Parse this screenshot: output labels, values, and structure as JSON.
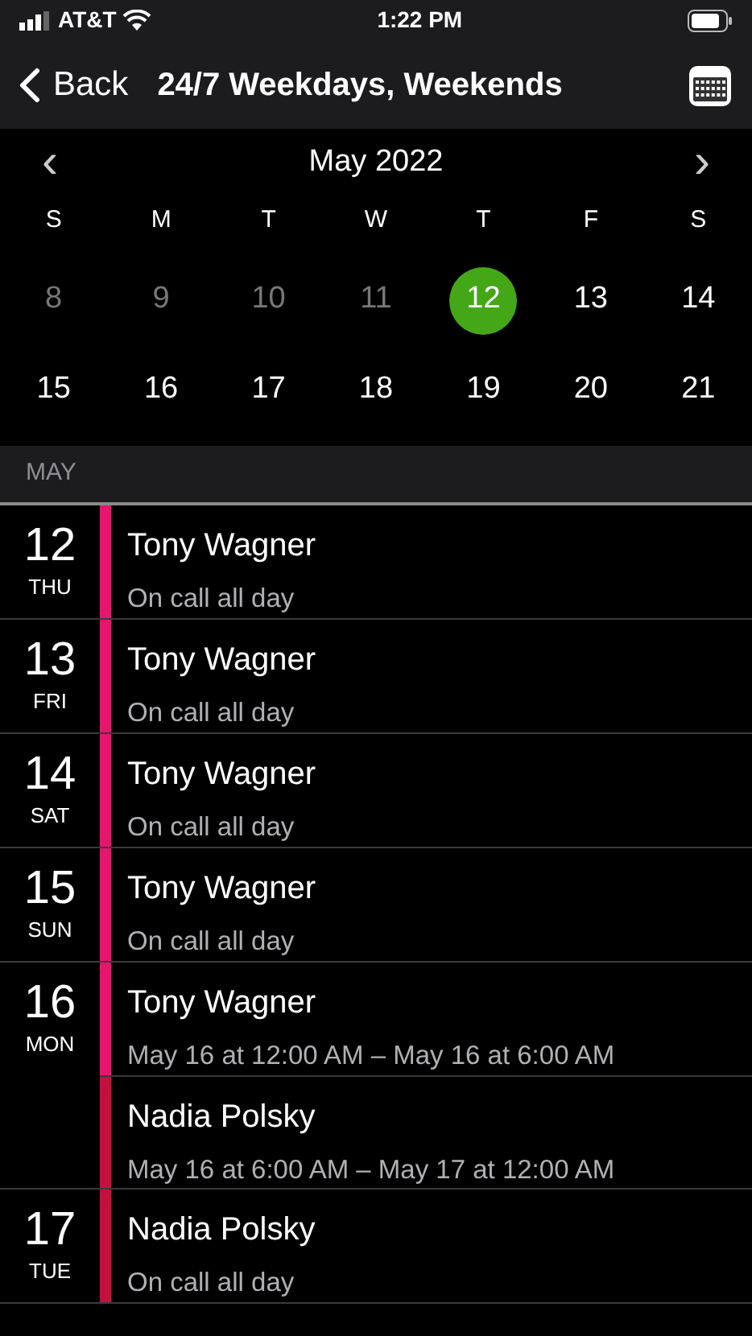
{
  "status_bar": {
    "carrier": "AT&T",
    "time": "1:22 PM"
  },
  "nav": {
    "back": "Back",
    "title": "24/7 Weekdays, Weekends"
  },
  "calendar": {
    "month": "May 2022",
    "prev": "‹",
    "next": "›",
    "weekdays": [
      "S",
      "M",
      "T",
      "W",
      "T",
      "F",
      "S"
    ],
    "days": [
      {
        "label": "8",
        "dimmed": true,
        "selected": false
      },
      {
        "label": "9",
        "dimmed": true,
        "selected": false
      },
      {
        "label": "10",
        "dimmed": true,
        "selected": false
      },
      {
        "label": "11",
        "dimmed": true,
        "selected": false
      },
      {
        "label": "12",
        "dimmed": false,
        "selected": true
      },
      {
        "label": "13",
        "dimmed": false,
        "selected": false
      },
      {
        "label": "14",
        "dimmed": false,
        "selected": false
      },
      {
        "label": "15",
        "dimmed": false,
        "selected": false
      },
      {
        "label": "16",
        "dimmed": false,
        "selected": false
      },
      {
        "label": "17",
        "dimmed": false,
        "selected": false
      },
      {
        "label": "18",
        "dimmed": false,
        "selected": false
      },
      {
        "label": "19",
        "dimmed": false,
        "selected": false
      },
      {
        "label": "20",
        "dimmed": false,
        "selected": false
      },
      {
        "label": "21",
        "dimmed": false,
        "selected": false
      }
    ]
  },
  "section_header": "MAY",
  "agenda": [
    {
      "day": "12",
      "weekday": "THU",
      "entries": [
        {
          "name": "Tony Wagner",
          "detail": "On call all day",
          "color": "#e3176e"
        }
      ]
    },
    {
      "day": "13",
      "weekday": "FRI",
      "entries": [
        {
          "name": "Tony Wagner",
          "detail": "On call all day",
          "color": "#e3176e"
        }
      ]
    },
    {
      "day": "14",
      "weekday": "SAT",
      "entries": [
        {
          "name": "Tony Wagner",
          "detail": "On call all day",
          "color": "#e3176e"
        }
      ]
    },
    {
      "day": "15",
      "weekday": "SUN",
      "entries": [
        {
          "name": "Tony Wagner",
          "detail": "On call all day",
          "color": "#e3176e"
        }
      ]
    },
    {
      "day": "16",
      "weekday": "MON",
      "entries": [
        {
          "name": "Tony Wagner",
          "detail": "May 16 at 12:00 AM – May 16 at 6:00 AM",
          "color": "#e3176e"
        },
        {
          "name": "Nadia Polsky",
          "detail": "May 16 at 6:00 AM – May 17 at 12:00 AM",
          "color": "#c2103f"
        }
      ]
    },
    {
      "day": "17",
      "weekday": "TUE",
      "entries": [
        {
          "name": "Nadia Polsky",
          "detail": "On call all day",
          "color": "#c2103f"
        }
      ]
    }
  ]
}
